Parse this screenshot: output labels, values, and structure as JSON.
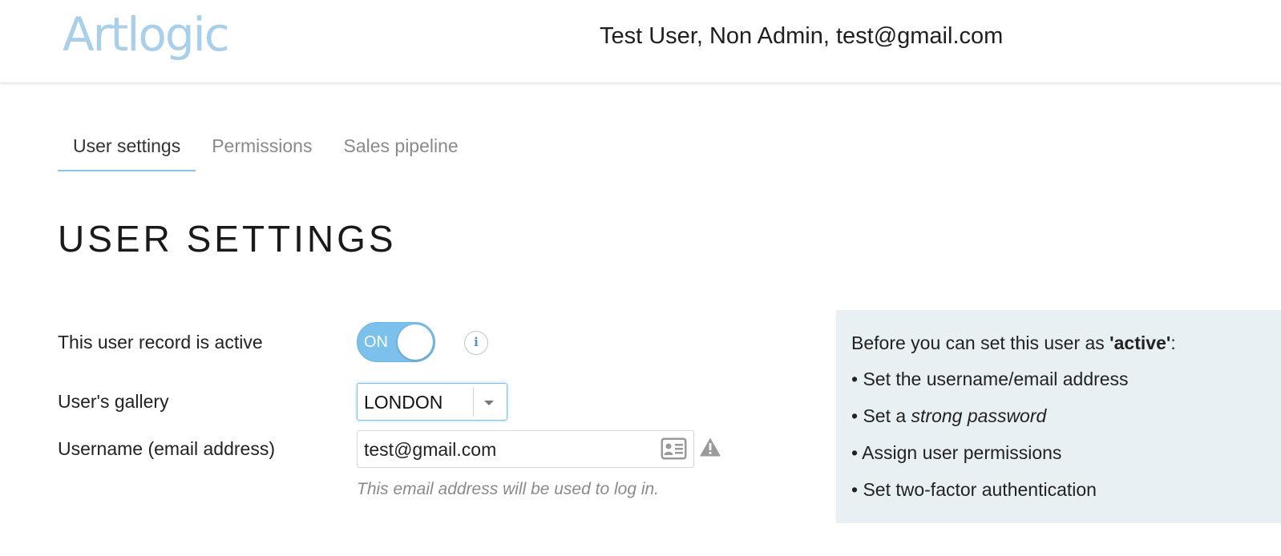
{
  "header": {
    "logo_text": "Artlogic",
    "user_info": "Test User, Non Admin, test@gmail.com"
  },
  "tabs": [
    {
      "label": "User settings",
      "active": true
    },
    {
      "label": "Permissions",
      "active": false
    },
    {
      "label": "Sales pipeline",
      "active": false
    }
  ],
  "page_title": "USER SETTINGS",
  "form": {
    "active": {
      "label": "This user record is active",
      "toggle_text": "ON",
      "toggle_on": true
    },
    "gallery": {
      "label": "User's gallery",
      "value": "LONDON"
    },
    "username": {
      "label": "Username (email address)",
      "value": "test@gmail.com",
      "help": "This email address will be used to log in."
    }
  },
  "info_box": {
    "heading_prefix": "Before you can set this user as ",
    "heading_bold": "'active'",
    "heading_suffix": ":",
    "items": [
      {
        "prefix": "• Set the username/email address",
        "emphasis": "",
        "suffix": ""
      },
      {
        "prefix": "• Set a ",
        "emphasis": "strong password",
        "suffix": ""
      },
      {
        "prefix": "• Assign user permissions",
        "emphasis": "",
        "suffix": ""
      },
      {
        "prefix": "• Set two-factor authentication",
        "emphasis": "",
        "suffix": ""
      }
    ]
  },
  "icons": {
    "info": "info-icon",
    "contact_card": "contact-card-icon",
    "warning": "warning-icon",
    "caret": "chevron-down-icon"
  },
  "colors": {
    "accent": "#7cc0ec",
    "logo": "#a9cfe9",
    "info_box_bg": "#e8f0f4",
    "tab_underline": "#8cc5e6"
  }
}
